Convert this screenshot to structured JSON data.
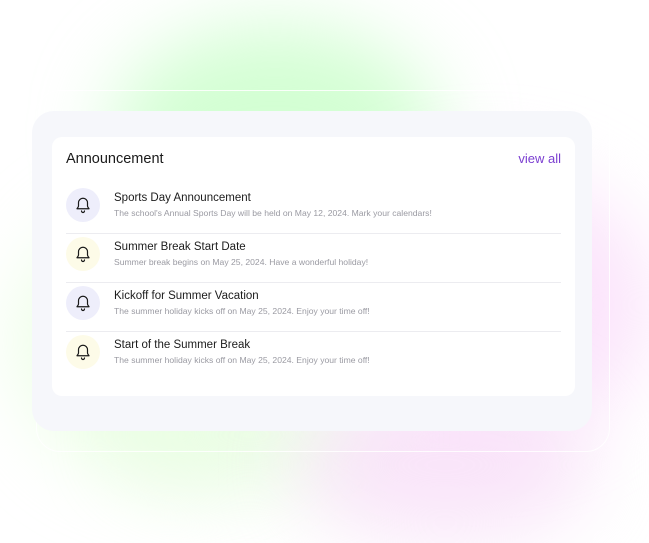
{
  "announcements_card": {
    "title": "Announcement",
    "view_all_label": "view all",
    "items": [
      {
        "title": "Sports Day Announcement",
        "description": "The school's Annual Sports Day will be held on May 12, 2024. Mark your calendars!",
        "icon": "bell-icon",
        "icon_bg": "#eeeefb"
      },
      {
        "title": "Summer Break Start Date",
        "description": "Summer break begins on May 25, 2024. Have a wonderful holiday!",
        "icon": "bell-icon",
        "icon_bg": "#fdfbe8"
      },
      {
        "title": "Kickoff for Summer Vacation",
        "description": "The summer holiday kicks off on May 25, 2024. Enjoy your time off!",
        "icon": "bell-icon",
        "icon_bg": "#eeeefb"
      },
      {
        "title": "Start of the Summer Break",
        "description": "The summer holiday kicks off on May 25, 2024. Enjoy your time off!",
        "icon": "bell-icon",
        "icon_bg": "#fdfbe8"
      }
    ]
  },
  "colors": {
    "accent": "#7b3fd1",
    "card_background": "#f6f7fb",
    "panel_background": "#ffffff",
    "title_text": "#1a1a1a",
    "muted_text": "#9a9aa2"
  }
}
